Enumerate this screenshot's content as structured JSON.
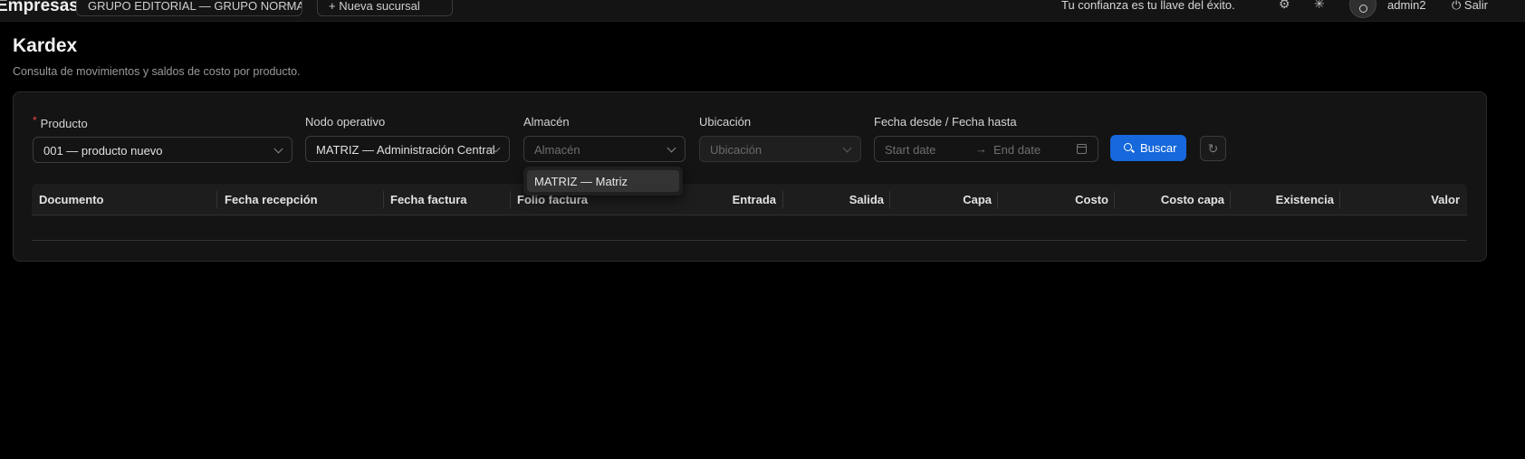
{
  "topbar": {
    "brand": "Empresas",
    "company_select": "GRUPO EDITORIAL — GRUPO NORMAL",
    "new_branch": "+ Nueva sucursal",
    "quote": "Tu confianza es tu llave del éxito.",
    "user": "admin2",
    "exit": "Salir"
  },
  "page": {
    "title": "Kardex",
    "subtitle": "Consulta de movimientos y saldos de costo por producto."
  },
  "filters": {
    "product": {
      "label": "Producto",
      "value": "001 — producto nuevo",
      "required": true
    },
    "node": {
      "label": "Nodo operativo",
      "value": "MATRIZ — Administración Central"
    },
    "warehouse": {
      "label": "Almacén",
      "placeholder": "Almacén"
    },
    "location": {
      "label": "Ubicación",
      "placeholder": "Ubicación"
    },
    "dates": {
      "label": "Fecha desde / Fecha hasta",
      "start_placeholder": "Start date",
      "end_placeholder": "End date"
    },
    "search_button": "Buscar"
  },
  "warehouse_dropdown": {
    "options": [
      "MATRIZ — Matriz"
    ]
  },
  "table": {
    "columns": [
      "Documento",
      "Fecha recepción",
      "Fecha factura",
      "Folio factura",
      "Entrada",
      "Salida",
      "Capa",
      "Costo",
      "Costo capa",
      "Existencia",
      "Valor"
    ],
    "rows": []
  },
  "colors": {
    "background": "#000000",
    "card": "#141414",
    "primary": "#1668dc",
    "required": "#e8483e"
  }
}
